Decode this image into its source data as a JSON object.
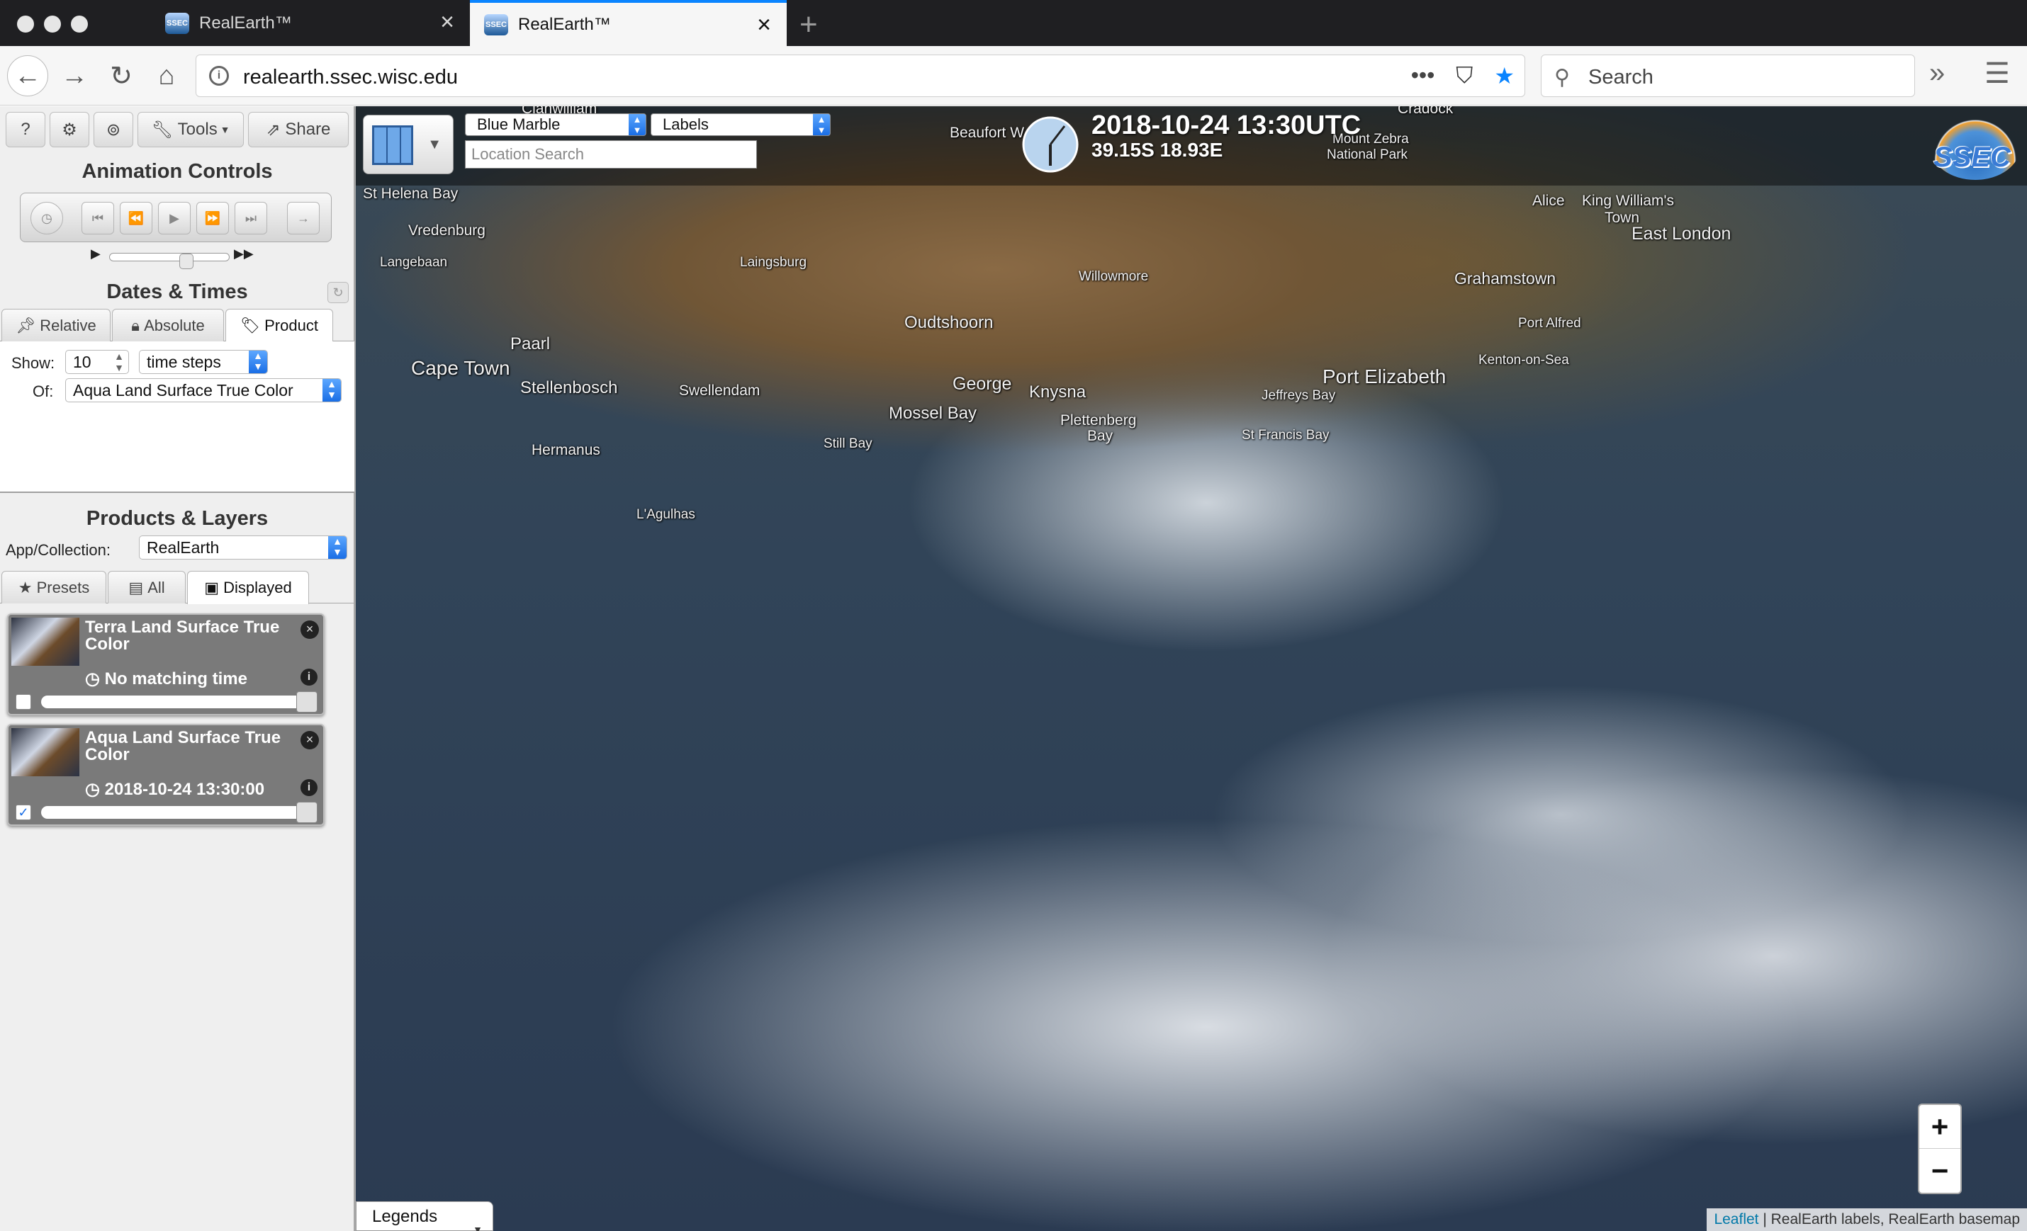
{
  "browser": {
    "tabs": [
      {
        "title": "RealEarth™",
        "active": false
      },
      {
        "title": "RealEarth™",
        "active": true
      }
    ],
    "new_tab": "+",
    "url": "realearth.ssec.wisc.edu",
    "page_actions": "•••",
    "search_placeholder": "Search",
    "favicon_text": "SSEC"
  },
  "sidebar": {
    "top_buttons": {
      "help": "?",
      "settings": "⚙",
      "user": "⊚",
      "tools": "Tools",
      "share": "Share"
    },
    "animation_title": "Animation Controls",
    "dates_title": "Dates & Times",
    "date_tabs": [
      "Relative",
      "Absolute",
      "Product"
    ],
    "selected_date_tab": "Product",
    "show_label": "Show:",
    "show_value": "10",
    "show_unit": "time steps",
    "of_label": "Of:",
    "of_value": "Aqua Land Surface True Color",
    "products_title": "Products & Layers",
    "app_label": "App/Collection:",
    "app_value": "RealEarth",
    "product_tabs": [
      "Presets",
      "All",
      "Displayed"
    ],
    "selected_product_tab": "Displayed",
    "layers": [
      {
        "title": "Terra Land Surface True Color",
        "status": "No matching time",
        "checked": false
      },
      {
        "title": "Aqua Land Surface True Color",
        "status": "2018-10-24 13:30:00",
        "checked": true
      }
    ]
  },
  "map": {
    "basemap": "Blue Marble",
    "overlay": "Labels",
    "location_placeholder": "Location Search",
    "datetime": "2018-10-24 13:30UTC",
    "coords": "39.15S 18.93E",
    "logo_text": "SSEC",
    "zoom_in": "+",
    "zoom_out": "−",
    "legends_label": "Legends",
    "attribution_link": "Leaflet",
    "attribution_text": " | RealEarth labels, RealEarth basemap",
    "places": {
      "clanwilliam": "Clanwilliam",
      "beaufort_west": "Beaufort W",
      "cradock": "Cradock",
      "mount_zebra": "Mount Zebra",
      "national_park": "National Park",
      "st_helena_bay": "St Helena Bay",
      "vredenburg": "Vredenburg",
      "langebaan": "Langebaan",
      "laingsburg": "Laingsburg",
      "willowmore": "Willowmore",
      "alice": "Alice",
      "king_williams": "King William's",
      "town": "Town",
      "east_london": "East London",
      "grahamstown": "Grahamstown",
      "oudtshoorn": "Oudtshoorn",
      "paarl": "Paarl",
      "port_alfred": "Port Alfred",
      "kenton": "Kenton-on-Sea",
      "cape_town": "Cape Town",
      "stellenbosch": "Stellenbosch",
      "swellendam": "Swellendam",
      "george": "George",
      "knysna": "Knysna",
      "port_elizabeth": "Port Elizabeth",
      "jeffreys_bay": "Jeffreys Bay",
      "mossel_bay": "Mossel Bay",
      "plettenberg": "Plettenberg",
      "bay": "Bay",
      "st_francis_bay": "St Francis Bay",
      "still_bay": "Still Bay",
      "hermanus": "Hermanus",
      "l_agulhas": "L'Agulhas"
    }
  }
}
